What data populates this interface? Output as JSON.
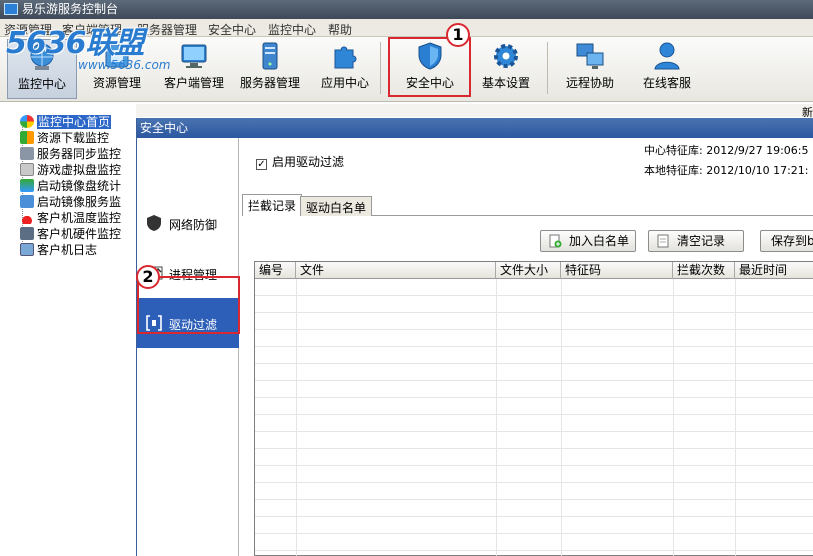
{
  "window": {
    "title": "易乐游服务控制台"
  },
  "menu": {
    "items": [
      "资源管理",
      "客户端管理",
      "服务器管理",
      "安全中心",
      "监控中心",
      "帮助"
    ]
  },
  "watermark": {
    "logo": "5636联盟",
    "url": "www.5636.com"
  },
  "toolbar": {
    "items": [
      {
        "label": "监控中心",
        "icon": "globe-monitor-icon"
      },
      {
        "label": "资源管理",
        "icon": "resource-icon"
      },
      {
        "label": "客户端管理",
        "icon": "monitor-icon"
      },
      {
        "label": "服务器管理",
        "icon": "server-icon"
      },
      {
        "label": "应用中心",
        "icon": "puzzle-icon"
      },
      {
        "label": "安全中心",
        "icon": "shield-icon"
      },
      {
        "label": "基本设置",
        "icon": "gear-icon"
      },
      {
        "label": "远程协助",
        "icon": "remote-desktop-icon"
      },
      {
        "label": "在线客服",
        "icon": "user-support-icon"
      }
    ]
  },
  "annotations": {
    "badge1": "1",
    "badge2": "2"
  },
  "tree": {
    "items": [
      "监控中心首页",
      "资源下载监控",
      "服务器同步监控",
      "游戏虚拟盘监控",
      "启动镜像盘统计",
      "启动镜像服务监",
      "客户机温度监控",
      "客户机硬件监控",
      "客户机日志"
    ]
  },
  "behind": {
    "fragment": "新"
  },
  "dialog": {
    "title": "安全中心",
    "nav": [
      {
        "label": "网络防御",
        "icon": "shield-icon"
      },
      {
        "label": "进程管理",
        "icon": "process-chart-icon"
      },
      {
        "label": "驱动过滤",
        "icon": "driver-filter-icon"
      }
    ],
    "enable_label": "启用驱动过滤",
    "enable_checked": "✓",
    "center_db": "中心特征库: 2012/9/27 19:06:5",
    "local_db": "本地特征库: 2012/10/10 17:21:",
    "tabs": [
      "拦截记录",
      "驱动白名单"
    ],
    "buttons": {
      "add_whitelist": "加入白名单",
      "clear_records": "清空记录",
      "save_to": "保存到b"
    },
    "table": {
      "columns": [
        "编号",
        "文件",
        "文件大小",
        "特征码",
        "拦截次数",
        "最近时间"
      ]
    }
  },
  "colors": {
    "accent": "#2e5fb8",
    "highlight": "#d9282f"
  }
}
